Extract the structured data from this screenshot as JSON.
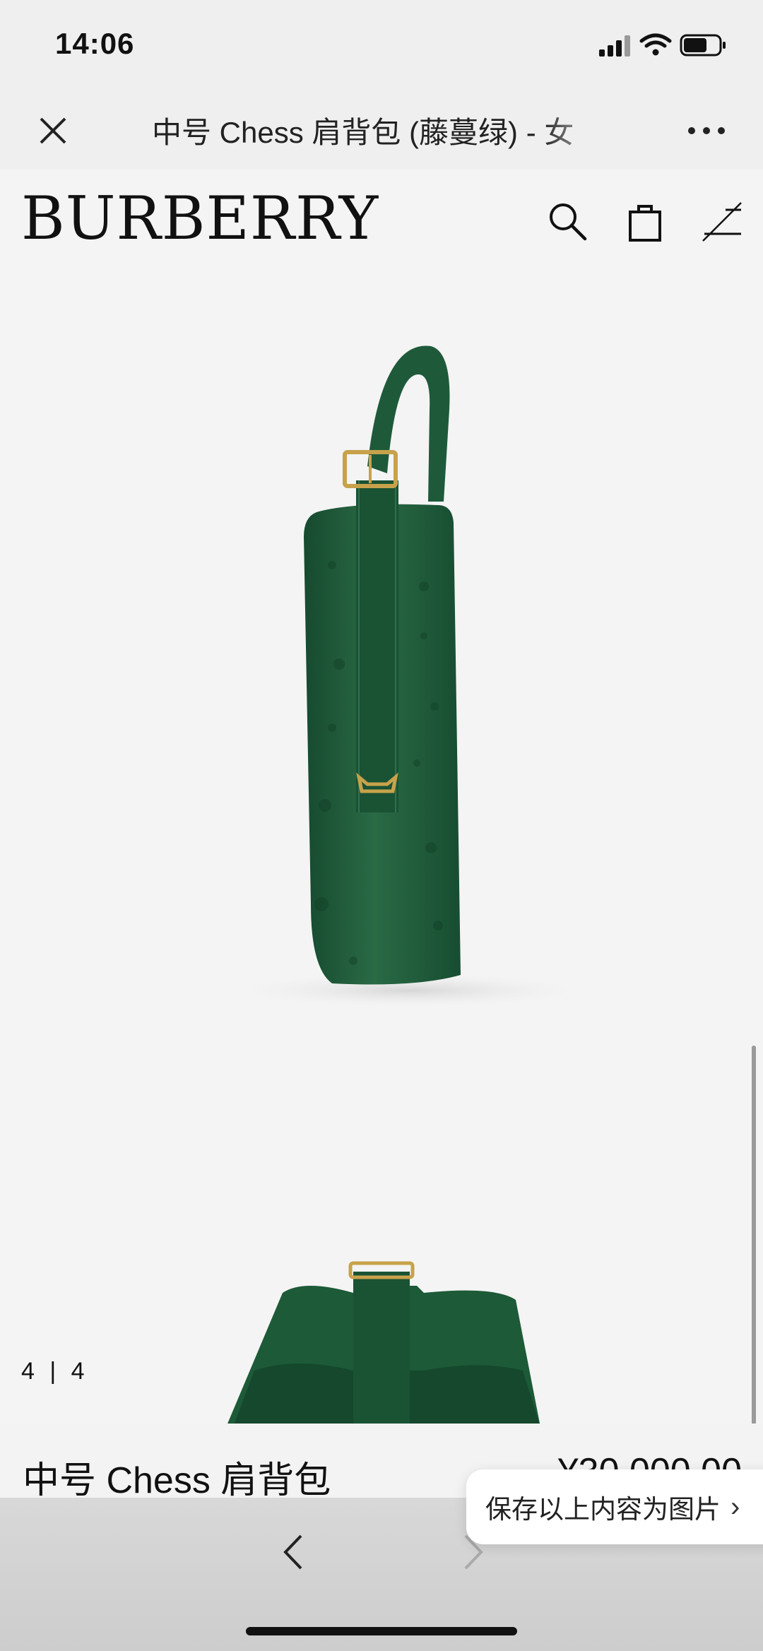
{
  "status": {
    "time": "14:06"
  },
  "nav": {
    "title": "中号 Chess 肩背包 (藤蔓绿) - 女"
  },
  "header": {
    "logo": "BURBERRY"
  },
  "gallery": {
    "pager": "4 | 4",
    "product_color": "#1f5a3a",
    "hardware_color": "#c8a24a"
  },
  "product": {
    "name": "中号 Chess 肩背包",
    "price": "¥30,000.00"
  },
  "save_pill": {
    "label": "保存以上内容为图片"
  },
  "icons": [
    "close-icon",
    "more-icon",
    "search-icon",
    "bag-icon",
    "menu-icon",
    "back-icon",
    "forward-icon"
  ]
}
